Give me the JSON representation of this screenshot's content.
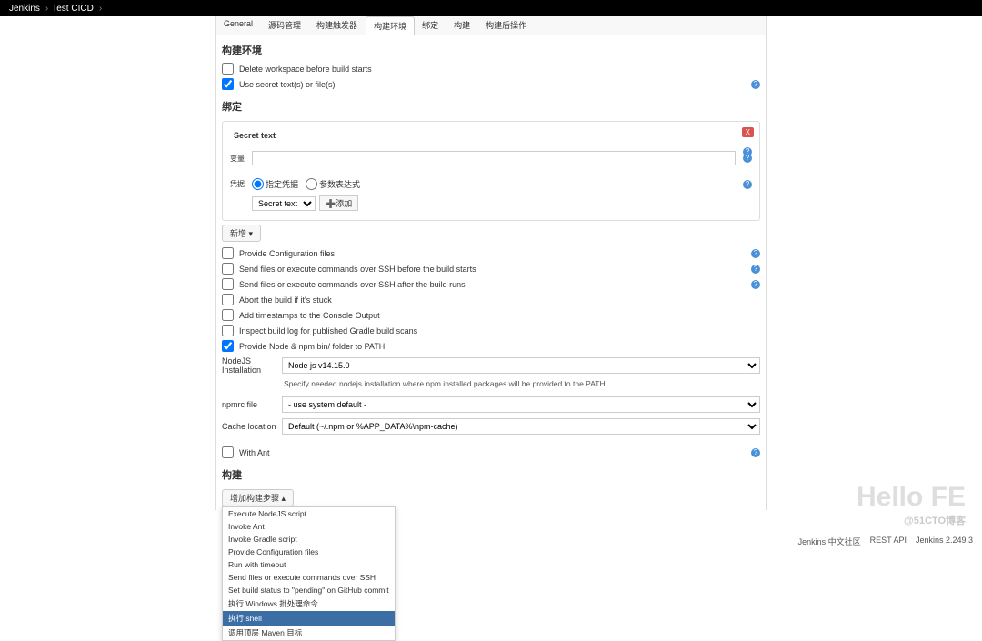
{
  "breadcrumb": {
    "jenkins": "Jenkins",
    "project": "Test CICD"
  },
  "tabs": {
    "general": "General",
    "source": "源码管理",
    "trigger": "构建触发器",
    "env": "构建环境",
    "binding": "绑定",
    "build": "构建",
    "postbuild": "构建后操作"
  },
  "build_env": {
    "title": "构建环境",
    "delete_ws": "Delete workspace before build starts",
    "use_secret": "Use secret text(s) or file(s)"
  },
  "binding_section": {
    "title": "绑定",
    "secret_text": "Secret text",
    "delete": "X",
    "var_label": "变量",
    "cred_label": "凭据",
    "radio_specific": "指定凭据",
    "radio_param": "参数表达式",
    "cred_select": "Secret text",
    "cred_add": "➕添加",
    "add_new": "新增"
  },
  "env_opts": {
    "provide_config": "Provide Configuration files",
    "ssh_before": "Send files or execute commands over SSH before the build starts",
    "ssh_after": "Send files or execute commands over SSH after the build runs",
    "abort_stuck": "Abort the build if it's stuck",
    "timestamps": "Add timestamps to the Console Output",
    "gradle_scan": "Inspect build log for published Gradle build scans",
    "provide_node": "Provide Node & npm bin/ folder to PATH"
  },
  "node": {
    "install_label": "NodeJS Installation",
    "install_value": "Node js v14.15.0",
    "desc": "Specify needed nodejs installation where npm installed packages will be provided to the PATH",
    "npmrc_label": "npmrc file",
    "npmrc_value": "- use system default -",
    "cache_label": "Cache location",
    "cache_value": "Default (~/.npm or %APP_DATA%\\npm-cache)"
  },
  "with_ant": "With Ant",
  "build_section": {
    "title": "构建",
    "add_step": "增加构建步骤",
    "menu": [
      "Execute NodeJS script",
      "Invoke Ant",
      "Invoke Gradle script",
      "Provide Configuration files",
      "Run with timeout",
      "Send files or execute commands over SSH",
      "Set build status to \"pending\" on GitHub commit",
      "执行 Windows 批处理命令",
      "执行 shell",
      "调用顶层 Maven 目标"
    ]
  },
  "footer": {
    "community": "Jenkins 中文社区",
    "rest": "REST API",
    "version": "Jenkins 2.249.3"
  },
  "watermark": {
    "main": "Hello FE",
    "sub": "@51CTO博客"
  }
}
